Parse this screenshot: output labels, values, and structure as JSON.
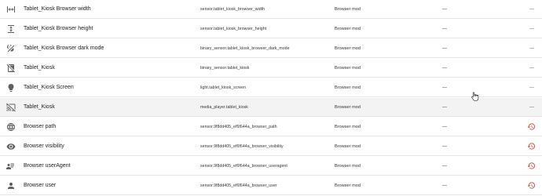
{
  "rows": [
    {
      "name": "Tablet_Kiosk Browser width",
      "entity": "sensor.tablet_kiosk_browser_width",
      "integration": "Browser mod",
      "area": "—",
      "status": "—",
      "icon": "arrow-expand-horizontal-icon"
    },
    {
      "name": "Tablet_Kiosk Browser height",
      "entity": "sensor.tablet_kiosk_browser_height",
      "integration": "Browser mod",
      "area": "—",
      "status": "—",
      "icon": "arrow-expand-vertical-icon"
    },
    {
      "name": "Tablet_Kiosk Browser dark mode",
      "entity": "binary_sensor.tablet_kiosk_browser_dark_mode",
      "integration": "Browser mod",
      "area": "—",
      "status": "—",
      "icon": "theme-light-dark-icon"
    },
    {
      "name": "Tablet_Kiosk",
      "entity": "binary_sensor.tablet_kiosk",
      "integration": "Browser mod",
      "area": "—",
      "status": "—",
      "icon": "tablet-off-icon"
    },
    {
      "name": "Tablet_Kiosk Screen",
      "entity": "light.tablet_kiosk_screen",
      "integration": "Browser mod",
      "area": "—",
      "status": "—",
      "icon": "lightbulb-icon"
    },
    {
      "name": "Tablet_Kiosk",
      "entity": "media_player.tablet_kiosk",
      "integration": "Browser mod",
      "area": "—",
      "status": "—",
      "icon": "cast-off-icon"
    },
    {
      "name": "Browser path",
      "entity": "sensor.9f8dd405_ef6f644a_browser_path",
      "integration": "Browser mod",
      "area": "—",
      "status": "",
      "icon": "web-icon"
    },
    {
      "name": "Browser visibility",
      "entity": "sensor.9f8dd405_ef6f644a_browser_visibility",
      "integration": "Browser mod",
      "area": "—",
      "status": "",
      "icon": "eye-icon"
    },
    {
      "name": "Browser userAgent",
      "entity": "sensor.9f8dd405_ef6f644a_browser_useragent",
      "integration": "Browser mod",
      "area": "—",
      "status": "",
      "icon": "account-details-icon"
    },
    {
      "name": "Browser user",
      "entity": "sensor.9f8dd405_ef6f644a_browser_user",
      "integration": "Browser mod",
      "area": "—",
      "status": "",
      "icon": "account-icon"
    }
  ],
  "highlighted_row": 5,
  "colors": {
    "restore_icon": "#db4437",
    "icon": "#5f5f5f",
    "row_hover": "#f3f3f3",
    "divider": "#e6e6e6"
  }
}
